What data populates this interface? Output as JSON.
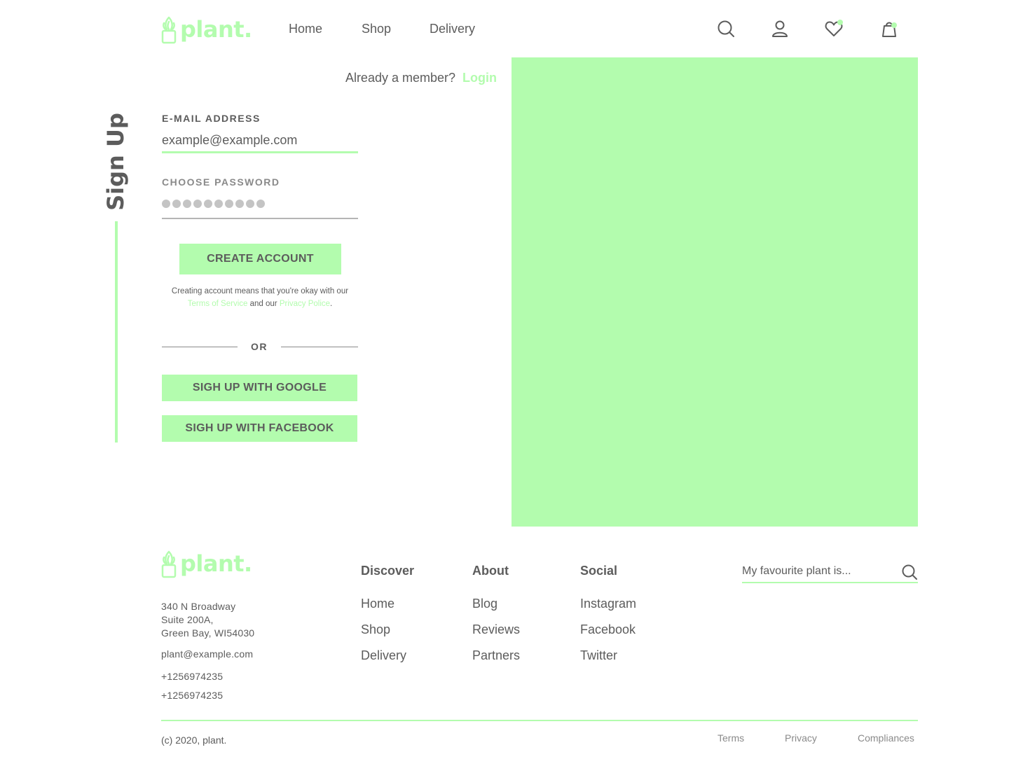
{
  "brand": {
    "name": "plant.",
    "color": "#b3fcae",
    "icon": "plant-pot-logo-icon"
  },
  "header": {
    "nav": [
      "Home",
      "Shop",
      "Delivery"
    ],
    "icons": [
      "search-icon",
      "user-icon",
      "heart-icon",
      "shopping-bag-icon"
    ]
  },
  "signup": {
    "title": "Sign Up",
    "member_text": "Already a member?",
    "login_label": "Login",
    "email_label": "E-MAIL ADDRESS",
    "email_value": "example@example.com",
    "password_label": "CHOOSE PASSWORD",
    "password_masked": "●●●●●●●●●●",
    "create_label": "CREATE ACCOUNT",
    "terms_pre": "Creating account means that you're okay with our",
    "terms_link": "Terms of Service",
    "terms_mid": " and our ",
    "privacy_link": "Privacy Police",
    "terms_post": ".",
    "or_label": "OR",
    "google_label": "SIGH UP WITH GOOGLE",
    "facebook_label": "SIGH UP WITH FACEBOOK"
  },
  "footer": {
    "address": [
      "340 N Broadway",
      "Suite 200A,",
      "Green Bay, WI54030"
    ],
    "email": "plant@example.com",
    "phones": [
      "+1256974235",
      "+1256974235"
    ],
    "columns": [
      {
        "title": "Discover",
        "links": [
          "Home",
          "Shop",
          "Delivery"
        ]
      },
      {
        "title": "About",
        "links": [
          "Blog",
          "Reviews",
          "Partners"
        ]
      },
      {
        "title": "Social",
        "links": [
          "Instagram",
          "Facebook",
          "Twitter"
        ]
      }
    ],
    "search_placeholder": "My favourite plant is...",
    "copyright": "(c) 2020, plant.",
    "legal": [
      "Terms",
      "Privacy",
      "Compliances"
    ]
  }
}
